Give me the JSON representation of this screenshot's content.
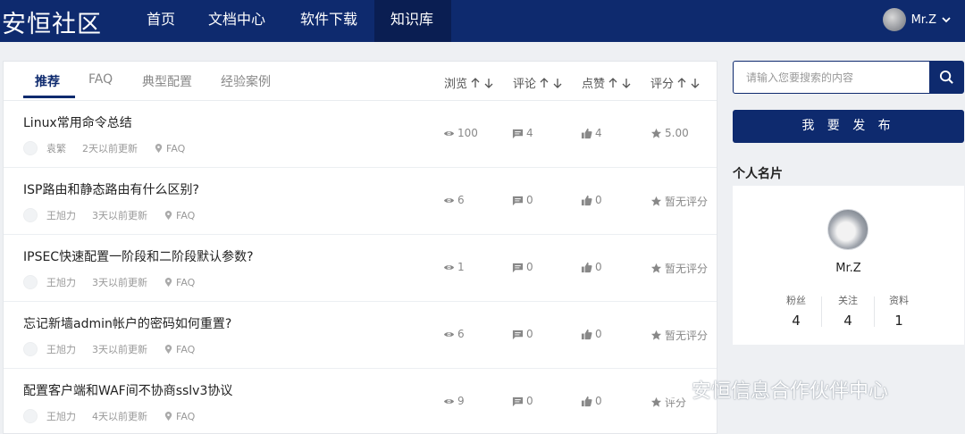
{
  "header": {
    "logo": "安恒社区",
    "nav": [
      "首页",
      "文档中心",
      "软件下载",
      "知识库"
    ],
    "user_name": "Mr.Z"
  },
  "tabs": [
    "推荐",
    "FAQ",
    "典型配置",
    "经验案例"
  ],
  "sort_columns": [
    "浏览",
    "评论",
    "点赞",
    "评分"
  ],
  "rows": [
    {
      "title": "Linux常用命令总结",
      "author": "袁繁",
      "time": "2天以前更新",
      "tag": "FAQ",
      "views": "100",
      "comments": "4",
      "likes": "4",
      "rating": "5.00"
    },
    {
      "title": "ISP路由和静态路由有什么区别?",
      "author": "王旭力",
      "time": "3天以前更新",
      "tag": "FAQ",
      "views": "6",
      "comments": "0",
      "likes": "0",
      "rating": "暂无评分"
    },
    {
      "title": "IPSEC快速配置一阶段和二阶段默认参数?",
      "author": "王旭力",
      "time": "3天以前更新",
      "tag": "FAQ",
      "views": "1",
      "comments": "0",
      "likes": "0",
      "rating": "暂无评分"
    },
    {
      "title": "忘记新墙admin帐户的密码如何重置?",
      "author": "王旭力",
      "time": "3天以前更新",
      "tag": "FAQ",
      "views": "6",
      "comments": "0",
      "likes": "0",
      "rating": "暂无评分"
    },
    {
      "title": "配置客户端和WAF间不协商sslv3协议",
      "author": "王旭力",
      "time": "4天以前更新",
      "tag": "FAQ",
      "views": "9",
      "comments": "0",
      "likes": "0",
      "rating": "评分"
    }
  ],
  "sidebar": {
    "search_placeholder": "请输入您要搜索的内容",
    "publish_label": "我 要 发 布",
    "card_title": "个人名片",
    "profile_name": "Mr.Z",
    "stats": [
      {
        "label": "粉丝",
        "value": "4"
      },
      {
        "label": "关注",
        "value": "4"
      },
      {
        "label": "资料",
        "value": "1"
      }
    ]
  },
  "watermark": "安恒信息合作伙伴中心",
  "colors": {
    "brand": "#0e2a6e",
    "nav_active": "#0a1e52"
  }
}
